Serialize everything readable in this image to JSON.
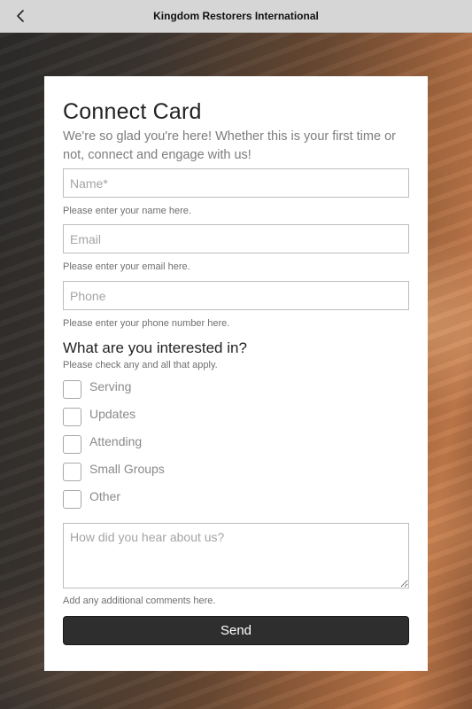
{
  "header": {
    "title": "Kingdom Restorers International",
    "back_icon": "chevron-left-icon"
  },
  "form": {
    "title": "Connect Card",
    "subtitle": "We're so glad you're here! Whether this is your first time or not, connect and engage with us!",
    "name": {
      "placeholder": "Name*",
      "value": "",
      "help": "Please enter your name here."
    },
    "email": {
      "placeholder": "Email",
      "value": "",
      "help": "Please enter your email here."
    },
    "phone": {
      "placeholder": "Phone",
      "value": "",
      "help": "Please enter your phone number here."
    },
    "interests": {
      "title": "What are you interested in?",
      "help": "Please check any and all that apply.",
      "options": [
        {
          "label": "Serving",
          "checked": false
        },
        {
          "label": "Updates",
          "checked": false
        },
        {
          "label": "Attending",
          "checked": false
        },
        {
          "label": "Small Groups",
          "checked": false
        },
        {
          "label": "Other",
          "checked": false
        }
      ]
    },
    "comments": {
      "placeholder": "How did you hear about us?",
      "value": "",
      "help": "Add any additional comments here."
    },
    "submit_label": "Send"
  },
  "colors": {
    "topbar": "#d6d6d6",
    "button": "#2e2e2e",
    "card": "#ffffff"
  }
}
